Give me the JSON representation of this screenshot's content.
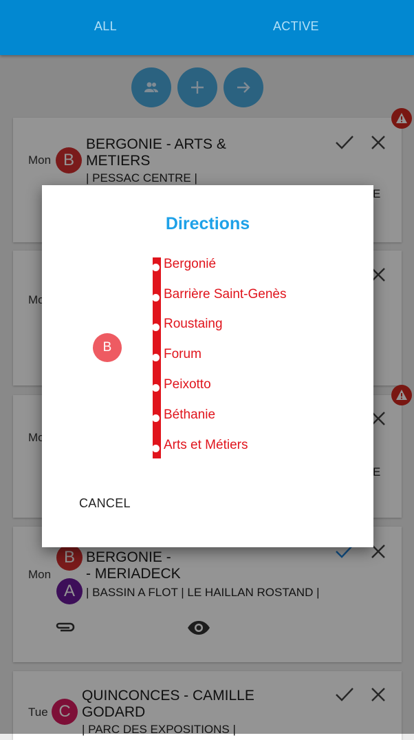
{
  "tabs": {
    "all": "ALL",
    "active": "ACTIVE"
  },
  "colors": {
    "primary": "#0288d1",
    "line": "#e0141c",
    "badge_b": "#d32f2f",
    "badge_a": "#6a1b9a",
    "badge_c": "#d81b60",
    "accent": "#1ea1e8"
  },
  "fabs": [
    "people-icon",
    "add-icon",
    "arrow-forward-icon"
  ],
  "cards": [
    {
      "day": "Mon",
      "badge": "B",
      "title_line1": "BERGONIE - ARTS &",
      "title_line2": "METIERS",
      "sub": "| PESSAC CENTRE |",
      "cut_right": "E"
    },
    {
      "day": "Mo"
    },
    {
      "day": "Mo",
      "cut_right": "E"
    },
    {
      "day": "Mon",
      "badge_top": "B",
      "badge_bottom": "A",
      "title_line1": "BERGONIE -",
      "title_line2": "- MERIADECK",
      "sub": "| BASSIN A FLOT | LE HAILLAN ROSTAND |"
    },
    {
      "day": "Tue",
      "badge": "C",
      "title_line1": "QUINCONCES - CAMILLE",
      "title_line2": "GODARD",
      "sub": "| PARC DES EXPOSITIONS |"
    }
  ],
  "dialog": {
    "title": "Directions",
    "badge": "B",
    "stops": [
      "Bergonié",
      "Barrière Saint-Genès",
      "Roustaing",
      "Forum",
      "Peixotto",
      "Béthanie",
      "Arts et Métiers"
    ],
    "cancel": "CANCEL"
  }
}
